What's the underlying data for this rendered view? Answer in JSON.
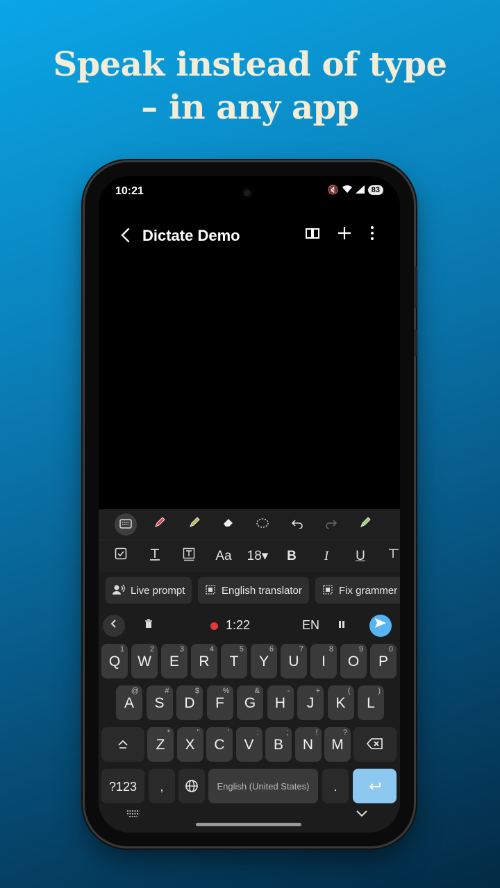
{
  "headline": {
    "line1": "Speak instead of type",
    "line2": "– in any app"
  },
  "status_bar": {
    "time": "10:21",
    "battery": "83"
  },
  "app_bar": {
    "title": "Dictate Demo"
  },
  "suggestion_chips": [
    {
      "label": "Live prompt",
      "icon": "person-voice-icon"
    },
    {
      "label": "English translator",
      "icon": "ai-chip-icon"
    },
    {
      "label": "Fix grammer",
      "icon": "ai-chip-icon"
    }
  ],
  "voice_bar": {
    "timer": "1:22",
    "language": "EN"
  },
  "format_toolbar": {
    "font_label": "Aa",
    "font_size": "18▾",
    "bold": "B",
    "italic": "I",
    "underline": "U"
  },
  "keyboard": {
    "row1": [
      {
        "k": "Q",
        "s": "1"
      },
      {
        "k": "W",
        "s": "2"
      },
      {
        "k": "E",
        "s": "3"
      },
      {
        "k": "R",
        "s": "4"
      },
      {
        "k": "T",
        "s": "5"
      },
      {
        "k": "Y",
        "s": "6"
      },
      {
        "k": "U",
        "s": "7"
      },
      {
        "k": "I",
        "s": "8"
      },
      {
        "k": "O",
        "s": "9"
      },
      {
        "k": "P",
        "s": "0"
      }
    ],
    "row2": [
      {
        "k": "A",
        "s": "@"
      },
      {
        "k": "S",
        "s": "#"
      },
      {
        "k": "D",
        "s": "$"
      },
      {
        "k": "F",
        "s": "%"
      },
      {
        "k": "G",
        "s": "&"
      },
      {
        "k": "H",
        "s": "-"
      },
      {
        "k": "J",
        "s": "+"
      },
      {
        "k": "K",
        "s": "("
      },
      {
        "k": "L",
        "s": ")"
      }
    ],
    "row3": [
      {
        "k": "Z",
        "s": "*"
      },
      {
        "k": "X",
        "s": "\""
      },
      {
        "k": "C",
        "s": "'"
      },
      {
        "k": "V",
        "s": ":"
      },
      {
        "k": "B",
        "s": ";"
      },
      {
        "k": "N",
        "s": "!"
      },
      {
        "k": "M",
        "s": "?"
      }
    ],
    "symbols_label": "?123",
    "comma": ",",
    "space_label": "English (United States)",
    "period": "."
  }
}
